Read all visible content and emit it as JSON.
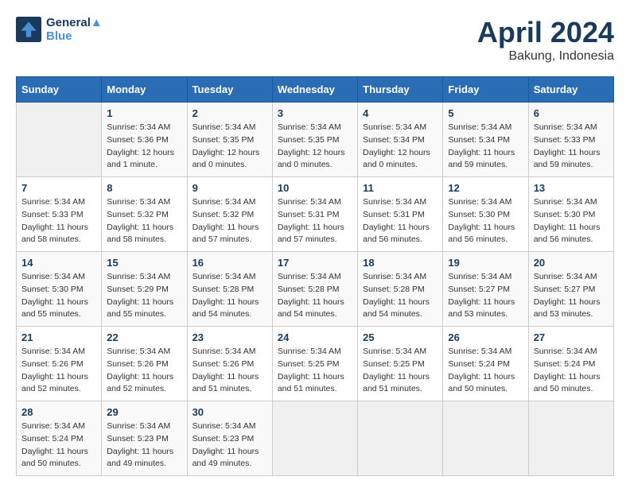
{
  "header": {
    "logo_line1": "General",
    "logo_line2": "Blue",
    "month_title": "April 2024",
    "location": "Bakung, Indonesia"
  },
  "days_of_week": [
    "Sunday",
    "Monday",
    "Tuesday",
    "Wednesday",
    "Thursday",
    "Friday",
    "Saturday"
  ],
  "weeks": [
    [
      {
        "day": "",
        "info": ""
      },
      {
        "day": "1",
        "info": "Sunrise: 5:34 AM\nSunset: 5:36 PM\nDaylight: 12 hours\nand 1 minute."
      },
      {
        "day": "2",
        "info": "Sunrise: 5:34 AM\nSunset: 5:35 PM\nDaylight: 12 hours\nand 0 minutes."
      },
      {
        "day": "3",
        "info": "Sunrise: 5:34 AM\nSunset: 5:35 PM\nDaylight: 12 hours\nand 0 minutes."
      },
      {
        "day": "4",
        "info": "Sunrise: 5:34 AM\nSunset: 5:34 PM\nDaylight: 12 hours\nand 0 minutes."
      },
      {
        "day": "5",
        "info": "Sunrise: 5:34 AM\nSunset: 5:34 PM\nDaylight: 11 hours\nand 59 minutes."
      },
      {
        "day": "6",
        "info": "Sunrise: 5:34 AM\nSunset: 5:33 PM\nDaylight: 11 hours\nand 59 minutes."
      }
    ],
    [
      {
        "day": "7",
        "info": "Sunrise: 5:34 AM\nSunset: 5:33 PM\nDaylight: 11 hours\nand 58 minutes."
      },
      {
        "day": "8",
        "info": "Sunrise: 5:34 AM\nSunset: 5:32 PM\nDaylight: 11 hours\nand 58 minutes."
      },
      {
        "day": "9",
        "info": "Sunrise: 5:34 AM\nSunset: 5:32 PM\nDaylight: 11 hours\nand 57 minutes."
      },
      {
        "day": "10",
        "info": "Sunrise: 5:34 AM\nSunset: 5:31 PM\nDaylight: 11 hours\nand 57 minutes."
      },
      {
        "day": "11",
        "info": "Sunrise: 5:34 AM\nSunset: 5:31 PM\nDaylight: 11 hours\nand 56 minutes."
      },
      {
        "day": "12",
        "info": "Sunrise: 5:34 AM\nSunset: 5:30 PM\nDaylight: 11 hours\nand 56 minutes."
      },
      {
        "day": "13",
        "info": "Sunrise: 5:34 AM\nSunset: 5:30 PM\nDaylight: 11 hours\nand 56 minutes."
      }
    ],
    [
      {
        "day": "14",
        "info": "Sunrise: 5:34 AM\nSunset: 5:30 PM\nDaylight: 11 hours\nand 55 minutes."
      },
      {
        "day": "15",
        "info": "Sunrise: 5:34 AM\nSunset: 5:29 PM\nDaylight: 11 hours\nand 55 minutes."
      },
      {
        "day": "16",
        "info": "Sunrise: 5:34 AM\nSunset: 5:28 PM\nDaylight: 11 hours\nand 54 minutes."
      },
      {
        "day": "17",
        "info": "Sunrise: 5:34 AM\nSunset: 5:28 PM\nDaylight: 11 hours\nand 54 minutes."
      },
      {
        "day": "18",
        "info": "Sunrise: 5:34 AM\nSunset: 5:28 PM\nDaylight: 11 hours\nand 54 minutes."
      },
      {
        "day": "19",
        "info": "Sunrise: 5:34 AM\nSunset: 5:27 PM\nDaylight: 11 hours\nand 53 minutes."
      },
      {
        "day": "20",
        "info": "Sunrise: 5:34 AM\nSunset: 5:27 PM\nDaylight: 11 hours\nand 53 minutes."
      }
    ],
    [
      {
        "day": "21",
        "info": "Sunrise: 5:34 AM\nSunset: 5:26 PM\nDaylight: 11 hours\nand 52 minutes."
      },
      {
        "day": "22",
        "info": "Sunrise: 5:34 AM\nSunset: 5:26 PM\nDaylight: 11 hours\nand 52 minutes."
      },
      {
        "day": "23",
        "info": "Sunrise: 5:34 AM\nSunset: 5:26 PM\nDaylight: 11 hours\nand 51 minutes."
      },
      {
        "day": "24",
        "info": "Sunrise: 5:34 AM\nSunset: 5:25 PM\nDaylight: 11 hours\nand 51 minutes."
      },
      {
        "day": "25",
        "info": "Sunrise: 5:34 AM\nSunset: 5:25 PM\nDaylight: 11 hours\nand 51 minutes."
      },
      {
        "day": "26",
        "info": "Sunrise: 5:34 AM\nSunset: 5:24 PM\nDaylight: 11 hours\nand 50 minutes."
      },
      {
        "day": "27",
        "info": "Sunrise: 5:34 AM\nSunset: 5:24 PM\nDaylight: 11 hours\nand 50 minutes."
      }
    ],
    [
      {
        "day": "28",
        "info": "Sunrise: 5:34 AM\nSunset: 5:24 PM\nDaylight: 11 hours\nand 50 minutes."
      },
      {
        "day": "29",
        "info": "Sunrise: 5:34 AM\nSunset: 5:23 PM\nDaylight: 11 hours\nand 49 minutes."
      },
      {
        "day": "30",
        "info": "Sunrise: 5:34 AM\nSunset: 5:23 PM\nDaylight: 11 hours\nand 49 minutes."
      },
      {
        "day": "",
        "info": ""
      },
      {
        "day": "",
        "info": ""
      },
      {
        "day": "",
        "info": ""
      },
      {
        "day": "",
        "info": ""
      }
    ]
  ]
}
